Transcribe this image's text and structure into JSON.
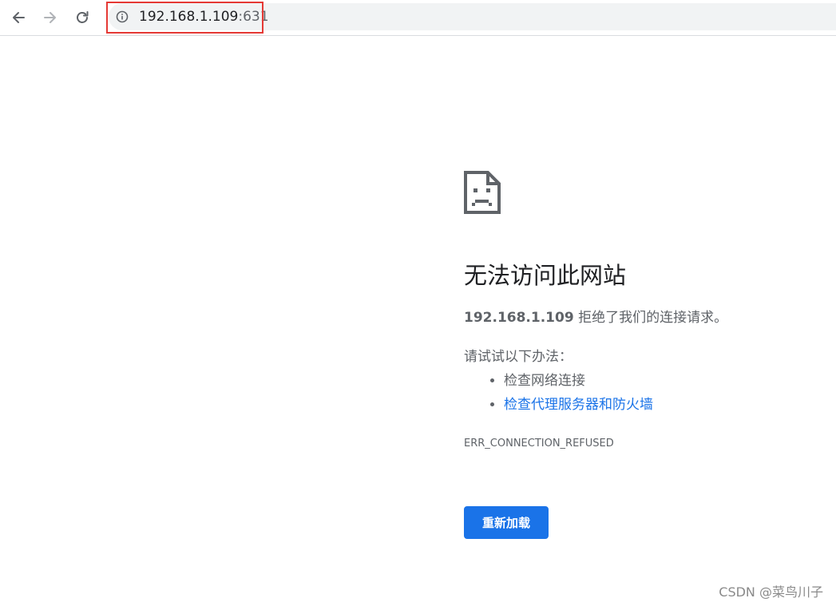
{
  "toolbar": {
    "back_icon": "arrow-left-icon",
    "forward_icon": "arrow-right-icon",
    "reload_icon": "reload-icon",
    "info_icon": "info-icon",
    "url_host": "192.168.1.109",
    "url_port": ":631",
    "highlight_color": "#e53935"
  },
  "error": {
    "icon": "sad-page-icon",
    "title": "无法访问此网站",
    "host": "192.168.1.109",
    "message": " 拒绝了我们的连接请求。",
    "suggest_heading": "请试试以下办法：",
    "suggestions": [
      "检查网络连接",
      "检查代理服务器和防火墙"
    ],
    "code": "ERR_CONNECTION_REFUSED",
    "reload_label": "重新加载",
    "accent_color": "#1a73e8"
  },
  "watermark": "CSDN @菜鸟川子"
}
